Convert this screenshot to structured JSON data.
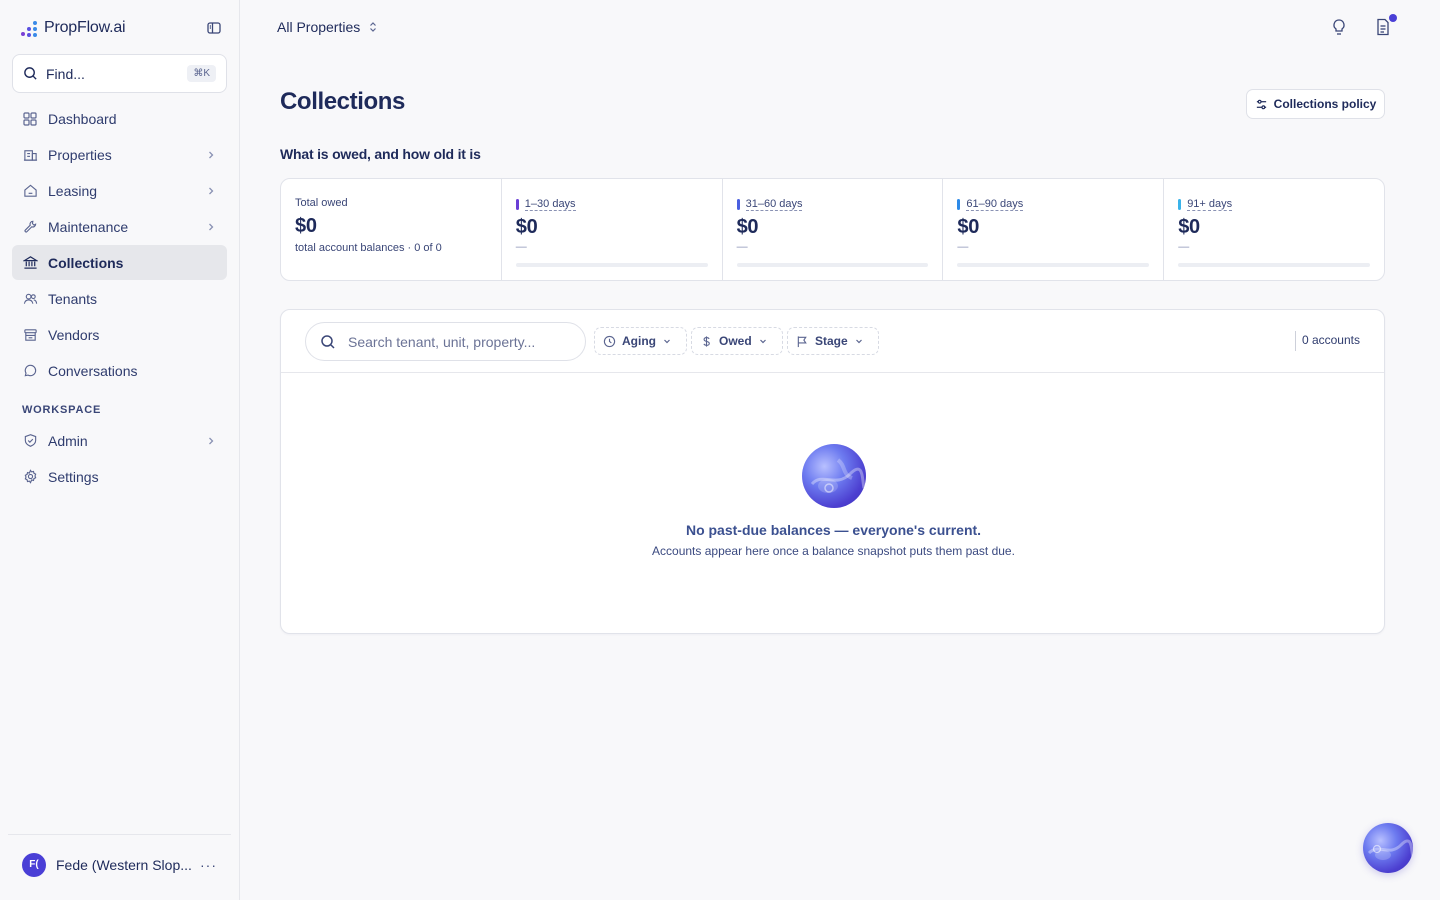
{
  "app": {
    "logo_text": "PropFlow.ai"
  },
  "search": {
    "label": "Find...",
    "shortcut": "⌘K"
  },
  "nav": {
    "items": [
      {
        "label": "Dashboard",
        "icon": "grid-icon"
      },
      {
        "label": "Properties",
        "icon": "building-icon"
      },
      {
        "label": "Leasing",
        "icon": "home-icon"
      },
      {
        "label": "Maintenance",
        "icon": "wrench-icon"
      },
      {
        "label": "Collections",
        "icon": "bank-icon",
        "active": true
      },
      {
        "label": "Tenants",
        "icon": "users-icon"
      },
      {
        "label": "Vendors",
        "icon": "store-icon"
      },
      {
        "label": "Conversations",
        "icon": "chat-icon"
      }
    ],
    "workspace_label": "WORKSPACE",
    "workspace_items": [
      {
        "label": "Admin",
        "icon": "shield-icon"
      },
      {
        "label": "Settings",
        "icon": "gear-icon"
      }
    ]
  },
  "user": {
    "initials": "F(",
    "name": "Fede (Western Slop..."
  },
  "topbar": {
    "property_selector": "All Properties"
  },
  "page": {
    "title": "Collections",
    "policy_button": "Collections policy",
    "subtitle": "What is owed, and how old it is"
  },
  "stats": {
    "total": {
      "label": "Total owed",
      "amount": "$0",
      "meta": "total account balances · 0 of 0"
    },
    "buckets": [
      {
        "label": "1–30 days",
        "amount": "$0",
        "detail": "—",
        "color": "#6a3fd6"
      },
      {
        "label": "31–60 days",
        "amount": "$0",
        "detail": "—",
        "color": "#4a5fe0"
      },
      {
        "label": "61–90 days",
        "amount": "$0",
        "detail": "—",
        "color": "#2d8ae8"
      },
      {
        "label": "91+ days",
        "amount": "$0",
        "detail": "—",
        "color": "#3ab3ea"
      }
    ]
  },
  "table": {
    "search_placeholder": "Search tenant, unit, property...",
    "filters": {
      "aging": "Aging",
      "owed": "Owed",
      "stage": "Stage"
    },
    "count": "0 accounts",
    "empty_title": "No past-due balances — everyone's current.",
    "empty_subtitle": "Accounts appear here once a balance snapshot puts them past due."
  }
}
